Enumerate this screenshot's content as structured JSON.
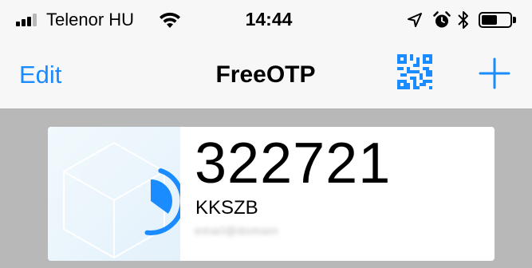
{
  "status_bar": {
    "carrier": "Telenor HU",
    "time": "14:44",
    "signal_bars_filled": 3,
    "signal_bars_total": 4,
    "battery_level": 0.55,
    "icons": [
      "signal-icon",
      "wifi-icon",
      "location-arrow-icon",
      "alarm-clock-icon",
      "bluetooth-icon",
      "battery-icon"
    ]
  },
  "nav_bar": {
    "edit_label": "Edit",
    "title": "FreeOTP",
    "scan_icon": "qr-code-icon",
    "add_icon": "plus-icon"
  },
  "tokens": [
    {
      "code": "322721",
      "issuer": "KKSZB",
      "label": "email@domain",
      "progress": 0.35,
      "icon": "freeotp-cube-logo"
    }
  ],
  "colors": {
    "accent": "#1a8cff",
    "background": "#b8b8b8",
    "card": "#ffffff",
    "bar": "#f7f7f7"
  }
}
